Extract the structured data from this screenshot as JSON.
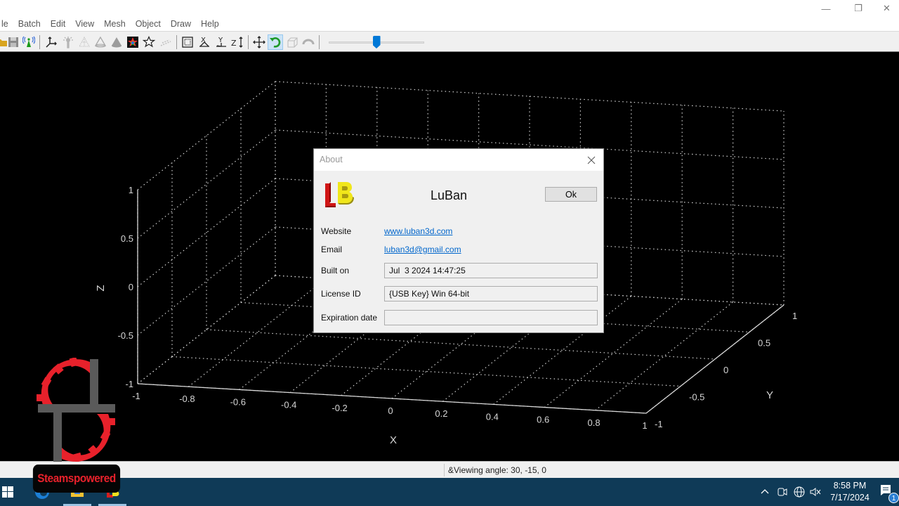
{
  "window": {
    "controls": {
      "minimize": "—",
      "maximize": "❐",
      "close": "✕"
    }
  },
  "menubar": {
    "items": [
      "le",
      "Batch",
      "Edit",
      "View",
      "Mesh",
      "Object",
      "Draw",
      "Help"
    ]
  },
  "toolbar": {
    "icons": [
      "open-icon",
      "save-icon",
      "broadcast-icon",
      "axes-icon",
      "light-icon",
      "wireframe-icon",
      "outline-cone-icon",
      "solid-cone-icon",
      "color-map-icon",
      "star-icon",
      "points-icon",
      "bounding-box-icon",
      "x-axis-view-icon",
      "y-axis-view-icon",
      "z-axis-view-icon",
      "pan-icon",
      "rotate-icon",
      "cube-view-icon",
      "undo-arc-icon"
    ],
    "active_tool": "rotate-icon",
    "slider": {
      "value_fraction": 0.5
    }
  },
  "viewport": {
    "background": "#000000",
    "chart_data": {
      "type": "3d-axes",
      "title": "",
      "xlabel": "X",
      "ylabel": "Y",
      "zlabel": "Z",
      "xlim": [
        -1,
        1
      ],
      "ylim": [
        -1,
        1
      ],
      "zlim": [
        -1,
        1
      ],
      "grid": true,
      "grid_style": "dotted",
      "x_ticks": [
        "-1",
        "-0.8",
        "-0.6",
        "-0.4",
        "-0.2",
        "0",
        "0.2",
        "0.4",
        "0.6",
        "0.8",
        "1"
      ],
      "y_ticks": [
        "-1",
        "-0.5",
        "0",
        "0.5",
        "1"
      ],
      "z_ticks": [
        "-1",
        "-0.5",
        "0",
        "0.5",
        "1"
      ],
      "x_tick_values": [
        -1,
        -0.8,
        -0.6,
        -0.4,
        -0.2,
        0,
        0.2,
        0.4,
        0.6,
        0.8,
        1
      ],
      "y_tick_values": [
        -1,
        -0.5,
        0,
        0.5,
        1
      ],
      "z_tick_values": [
        -1,
        -0.5,
        0,
        0.5,
        1
      ],
      "series": []
    }
  },
  "statusbar": {
    "text": "&Viewing angle: 30, -15, 0"
  },
  "dialog": {
    "title": "About",
    "app_name": "LuBan",
    "ok_label": "Ok",
    "rows": {
      "website_label": "Website",
      "website_value": "www.luban3d.com",
      "email_label": "Email",
      "email_value": "luban3d@gmail.com",
      "built_label": "Built on",
      "built_value": "Jul  3 2024 14:47:25",
      "license_label": "License ID",
      "license_value": "{USB Key} Win 64-bit",
      "expiration_label": "Expiration date",
      "expiration_value": ""
    }
  },
  "taskbar": {
    "apps": [
      "edge-icon",
      "file-explorer-icon",
      "luban-icon"
    ],
    "tray": {
      "time": "8:58 PM",
      "date": "7/17/2024",
      "notification_count": "1"
    }
  },
  "watermark": {
    "text": "Steamspowered",
    "color": "#e8212b"
  }
}
